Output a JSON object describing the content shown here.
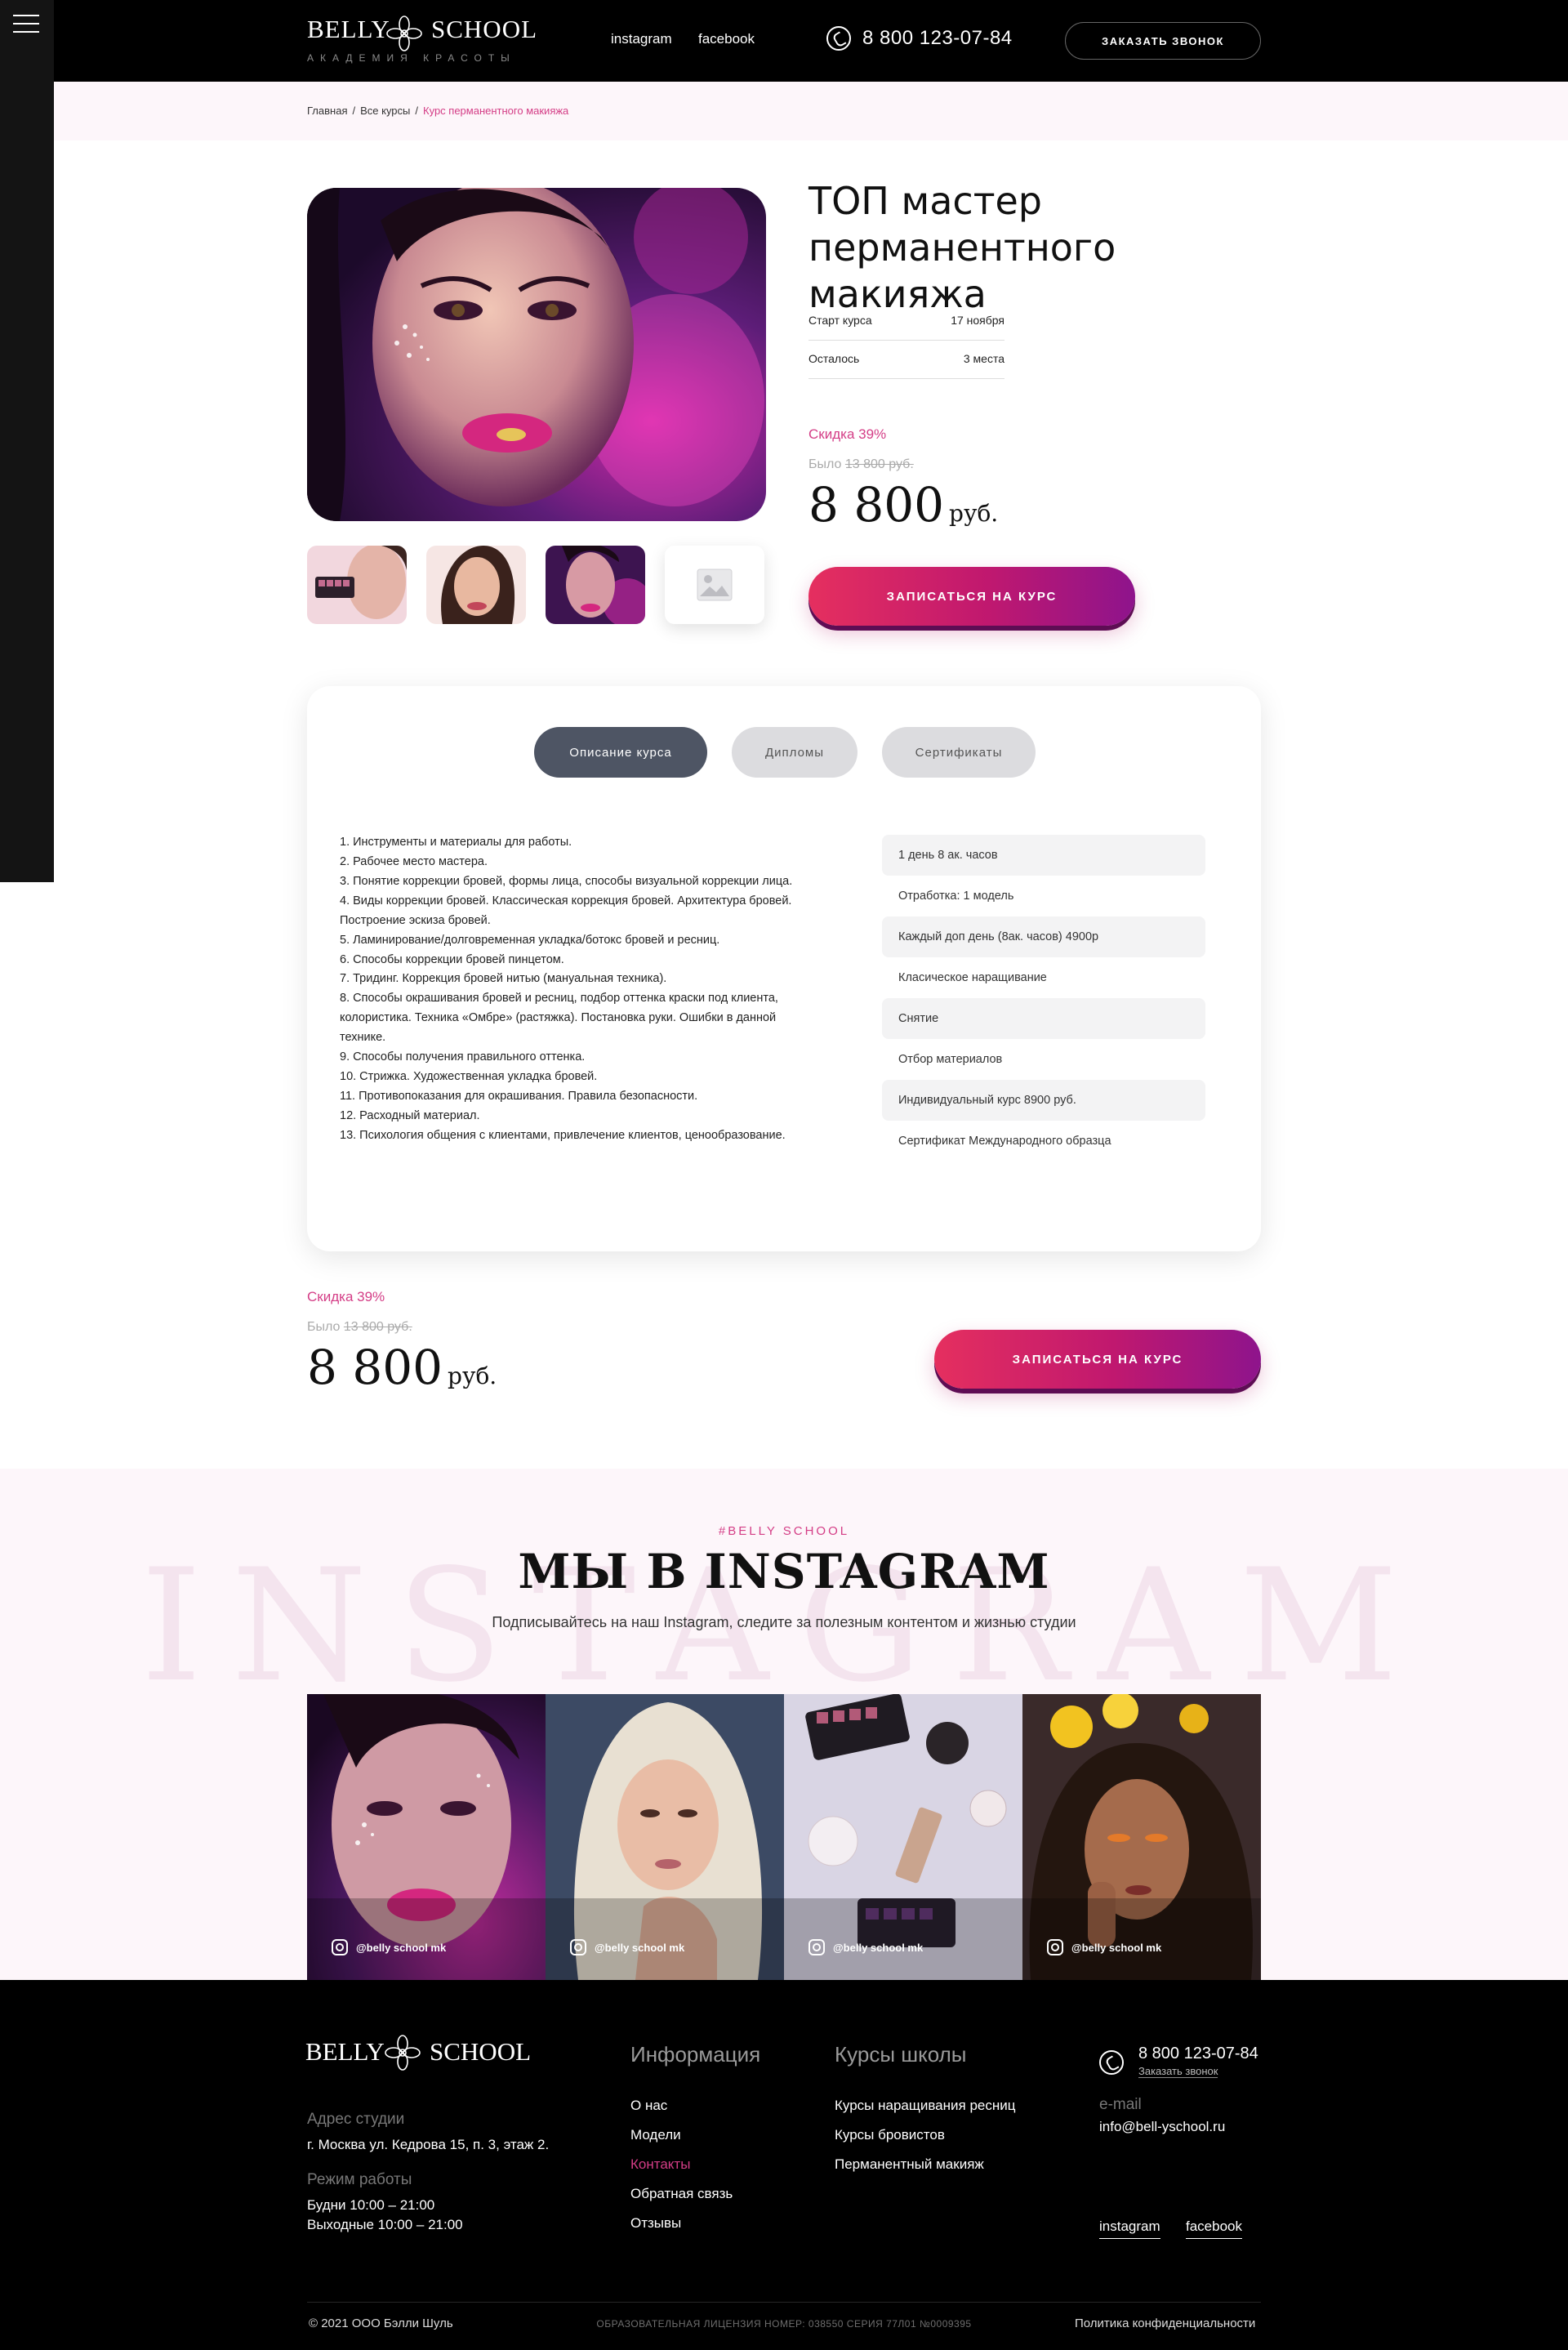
{
  "header": {
    "logo_left": "BELLY",
    "logo_right": "SCHOOL",
    "logo_sub": "АКАДЕМИЯ КРАСОТЫ",
    "links": [
      "instagram",
      "facebook"
    ],
    "phone": "8 800 123-07-84",
    "call_button": "ЗАКАЗАТЬ ЗВОНОК",
    "menu_icon": "hamburger-icon"
  },
  "breadcrumb": [
    "Главная",
    "Все курсы",
    "Курс перманентного макияжа"
  ],
  "product": {
    "title": "ТОП мастер перманентного макияжа",
    "info": [
      {
        "label": "Старт курса",
        "value": "17 ноября"
      },
      {
        "label": "Осталось",
        "value": "3 места"
      }
    ],
    "discount": "Скидка 39%",
    "was_label": "Было",
    "was_price": "13 800 руб.",
    "price": "8 800",
    "currency": "руб.",
    "enroll_button": "ЗАПИСАТЬСЯ НА КУРС",
    "thumb_empty_icon": "image-placeholder-icon"
  },
  "tabs": [
    "Описание курса",
    "Дипломы",
    "Сертификаты"
  ],
  "active_tab": "Описание курса",
  "description": [
    "1. Инструменты и материалы для работы.",
    "2. Рабочее место мастера.",
    "3. Понятие коррекции бровей, формы лица, способы визуальной коррекции лица.",
    "4. Виды коррекции бровей. Классическая коррекция бровей. Архитектура бровей. Построение эскиза бровей.",
    "5. Ламинирование/долговременная укладка/ботокс бровей и ресниц.",
    "6. Способы коррекции бровей пинцетом.",
    "7. Тридинг. Коррекция бровей нитью (мануальная техника).",
    "8. Способы окрашивания бровей и ресниц, подбор оттенка краски под клиента, колористика. Техника «Омбре» (растяжка). Постановка руки. Ошибки в данной технике.",
    "9. Способы получения правильного оттенка.",
    "10. Стрижка. Художественная укладка бровей.",
    "11. Противопоказания для окрашивания. Правила безопасности.",
    "12. Расходный материал.",
    "13. Психология общения с клиентами, привлечение клиентов, ценообразование."
  ],
  "features": [
    "1 день 8 ак. часов",
    "Отработка: 1 модель",
    "Каждый доп день (8ак. часов) 4900р",
    "Класическое наращивание",
    "Снятие",
    "Отбор материалов",
    "Индивидуальный курс 8900 руб.",
    "Сертификат Международного образца"
  ],
  "bottom_price": {
    "discount": "Скидка 39%",
    "was_label": "Было",
    "was_price": "13 800 руб.",
    "price": "8 800",
    "currency": "руб.",
    "enroll_button": "ЗАПИСАТЬСЯ НА КУРС"
  },
  "instagram": {
    "bg_word": "INSTAGRAM",
    "tag": "#BELLY SCHOOL",
    "title": "МЫ В INSTAGRAM",
    "subtitle": "Подписывайтесь на наш Instagram, следите за полезным контентом и жизнью студии",
    "posts": [
      "@belly school mk",
      "@belly school mk",
      "@belly school mk",
      "@belly school mk"
    ]
  },
  "footer": {
    "logo_left": "BELLY",
    "logo_right": "SCHOOL",
    "address_label": "Адрес студии",
    "address": "г. Москва ул. Кедрова 15, п. 3, этаж 2.",
    "hours_label": "Режим работы",
    "weekdays": "Будни  10:00 – 21:00",
    "weekends": "Выходные  10:00 – 21:00",
    "info_heading": "Информация",
    "info_links": [
      "О нас",
      "Модели",
      "Контакты",
      "Обратная связь",
      "Отзывы"
    ],
    "active_info_link": "Контакты",
    "courses_heading": "Курсы школы",
    "course_links": [
      "Курсы наращивания ресниц",
      "Курсы бровистов",
      "Перманентный макияж"
    ],
    "phone": "8 800 123-07-84",
    "call_link": "Заказать звонок",
    "email_label": "e-mail",
    "email": "info@bell-yschool.ru",
    "social": [
      "instagram",
      "facebook"
    ],
    "copyright": "© 2021 ООО Бэлли Шуль",
    "license": "ОБРАЗОВАТЕЛЬНАЯ ЛИЦЕНЗИЯ НОМЕР: 038550 СЕРИЯ 77Л01 №0009395",
    "privacy": "Политика конфиденциальности"
  },
  "colors": {
    "accent": "#d43d86",
    "header_bg": "#000000",
    "tab_active": "#4e5564",
    "button_start": "#e52f5f",
    "button_end": "#8e148c"
  }
}
